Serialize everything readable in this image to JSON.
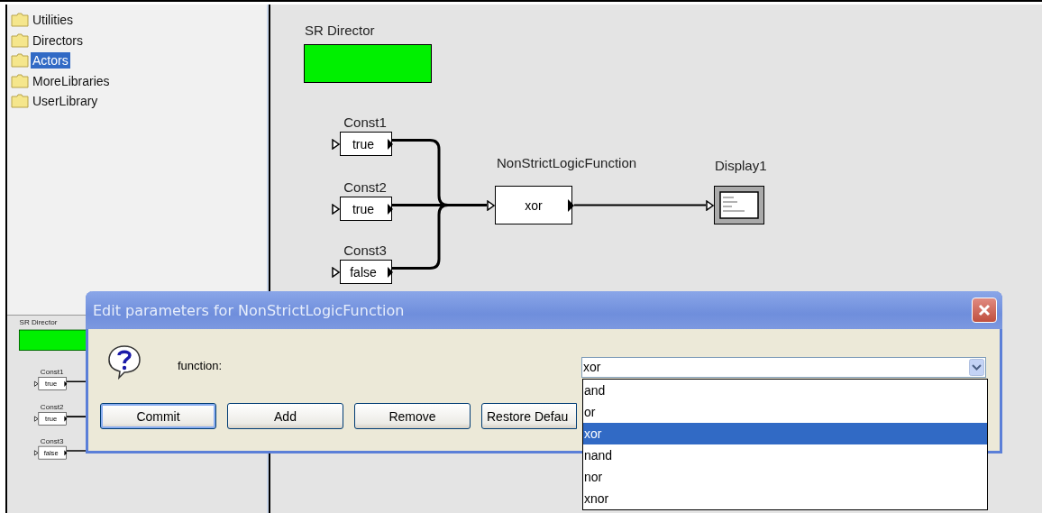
{
  "library_tree": {
    "items": [
      {
        "label": "Utilities",
        "selected": false
      },
      {
        "label": "Directors",
        "selected": false
      },
      {
        "label": "Actors",
        "selected": true
      },
      {
        "label": "MoreLibraries",
        "selected": false
      },
      {
        "label": "UserLibrary",
        "selected": false
      }
    ]
  },
  "overview": {
    "director": {
      "label": "SR Director"
    },
    "constants": [
      {
        "name": "Const1",
        "value": "true"
      },
      {
        "name": "Const2",
        "value": "true"
      },
      {
        "name": "Const3",
        "value": "false"
      }
    ]
  },
  "canvas": {
    "director": {
      "label": "SR Director"
    },
    "constants": [
      {
        "name": "Const1",
        "value": "true"
      },
      {
        "name": "Const2",
        "value": "true"
      },
      {
        "name": "Const3",
        "value": "false"
      }
    ],
    "function_block": {
      "name": "NonStrictLogicFunction",
      "value": "xor"
    },
    "display": {
      "name": "Display1"
    }
  },
  "dialog": {
    "title": "Edit parameters for NonStrictLogicFunction",
    "parameter": {
      "label": "function:",
      "value": "xor",
      "options": [
        {
          "label": "and",
          "selected": false
        },
        {
          "label": "or",
          "selected": false
        },
        {
          "label": "xor",
          "selected": true
        },
        {
          "label": "nand",
          "selected": false
        },
        {
          "label": "nor",
          "selected": false
        },
        {
          "label": "xnor",
          "selected": false
        }
      ]
    },
    "buttons": [
      {
        "label": "Commit",
        "focused": true
      },
      {
        "label": "Add",
        "focused": false
      },
      {
        "label": "Remove",
        "focused": false
      },
      {
        "label": "Restore Defau",
        "focused": false
      }
    ]
  }
}
